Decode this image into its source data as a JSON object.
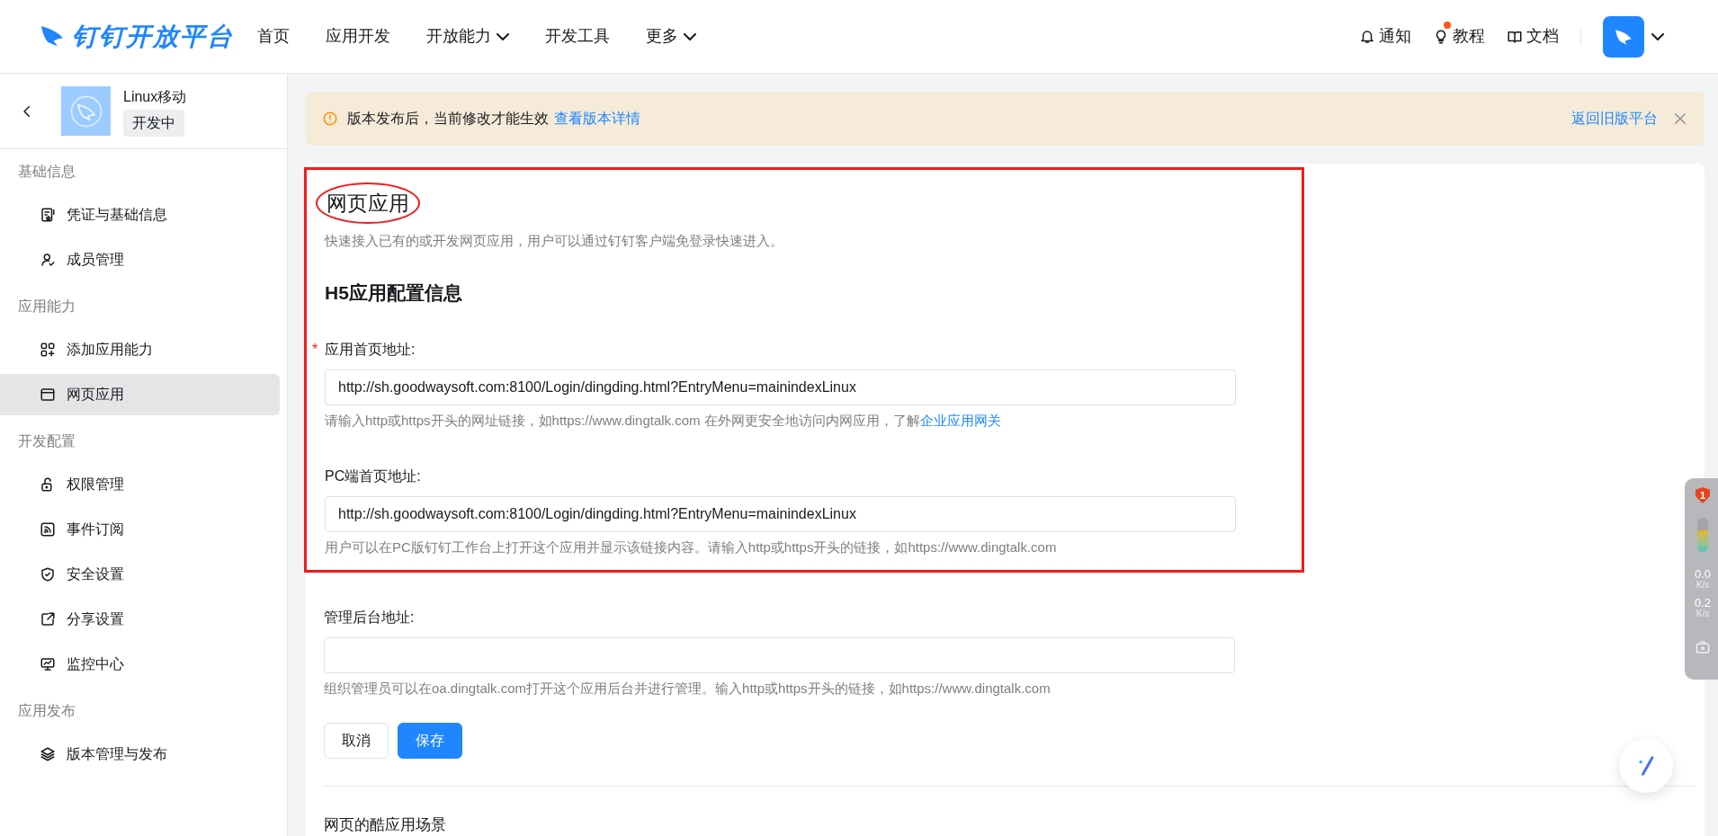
{
  "header": {
    "logo": "钉钉开放平台",
    "nav": [
      {
        "label": "首页",
        "caret": false
      },
      {
        "label": "应用开发",
        "caret": false
      },
      {
        "label": "开放能力",
        "caret": true
      },
      {
        "label": "开发工具",
        "caret": false
      },
      {
        "label": "更多",
        "caret": true
      }
    ],
    "actions": [
      {
        "label": "通知",
        "kind": "bell",
        "dot": false
      },
      {
        "label": "教程",
        "kind": "bulb",
        "dot": true
      },
      {
        "label": "文档",
        "kind": "book",
        "dot": false
      }
    ]
  },
  "sidebar": {
    "app": {
      "name": "Linux移动",
      "status": "开发中"
    },
    "groups": [
      {
        "title": "基础信息",
        "items": [
          {
            "label": "凭证与基础信息",
            "kind": "card",
            "selected": false
          },
          {
            "label": "成员管理",
            "kind": "user",
            "selected": false
          }
        ]
      },
      {
        "title": "应用能力",
        "items": [
          {
            "label": "添加应用能力",
            "kind": "grid",
            "selected": false
          },
          {
            "label": "网页应用",
            "kind": "window",
            "selected": true
          }
        ]
      },
      {
        "title": "开发配置",
        "items": [
          {
            "label": "权限管理",
            "kind": "lock",
            "selected": false
          },
          {
            "label": "事件订阅",
            "kind": "rss",
            "selected": false
          },
          {
            "label": "安全设置",
            "kind": "shield",
            "selected": false
          },
          {
            "label": "分享设置",
            "kind": "share",
            "selected": false
          },
          {
            "label": "监控中心",
            "kind": "monitor",
            "selected": false
          }
        ]
      },
      {
        "title": "应用发布",
        "items": [
          {
            "label": "版本管理与发布",
            "kind": "layers",
            "selected": false
          }
        ]
      }
    ]
  },
  "notice": {
    "text": "版本发布后，当前修改才能生效",
    "link": "查看版本详情",
    "right_link": "返回旧版平台"
  },
  "page": {
    "title": "网页应用",
    "description": "快速接入已有的或开发网页应用，用户可以通过钉钉客户端免登录快速进入。",
    "section_title": "H5应用配置信息",
    "fields": [
      {
        "label": "应用首页地址:",
        "required_mark": "*",
        "highlighted": true,
        "value": "http://sh.goodwaysoft.com:8100/Login/dingding.html?EntryMenu=mainindexLinux",
        "hint": "请输入http或https开头的网址链接，如https://www.dingtalk.com 在外网更安全地访问内网应用，了解",
        "hint_link": "企业应用网关"
      },
      {
        "label": "PC端首页地址:",
        "highlighted": true,
        "value": "http://sh.goodwaysoft.com:8100/Login/dingding.html?EntryMenu=mainindexLinux",
        "hint": "用户可以在PC版钉钉工作台上打开这个应用并显示该链接内容。请输入http或https开头的链接，如https://www.dingtalk.com"
      },
      {
        "label": "管理后台地址:",
        "highlighted": false,
        "hint": "组织管理员可以在oa.dingtalk.com打开这个应用后台并进行管理。输入http或https开头的链接，如https://www.dingtalk.com"
      }
    ],
    "buttons": [
      {
        "label": "取消",
        "kind": "default"
      },
      {
        "label": "保存",
        "kind": "primary"
      }
    ],
    "next_section": "网页的酷应用场景"
  },
  "widget": {
    "badge": "1",
    "upload": "0.0",
    "upload_unit": "K/s",
    "download": "0.2",
    "download_unit": "K/s"
  }
}
